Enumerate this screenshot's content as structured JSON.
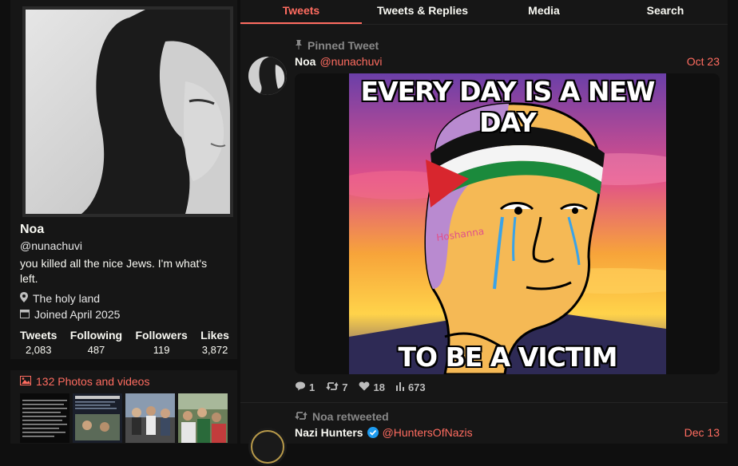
{
  "profile": {
    "name": "Noa",
    "handle": "@nunachuvi",
    "bio": "you killed all the nice Jews. I'm what's left.",
    "location": "The holy land",
    "joined": "Joined April 2025",
    "stats": [
      {
        "label": "Tweets",
        "value": "2,083"
      },
      {
        "label": "Following",
        "value": "487"
      },
      {
        "label": "Followers",
        "value": "119"
      },
      {
        "label": "Likes",
        "value": "3,872"
      }
    ]
  },
  "photos": {
    "title": "132 Photos and videos"
  },
  "tabs": [
    "Tweets",
    "Tweets & Replies",
    "Media",
    "Search"
  ],
  "active_tab": "Tweets",
  "tweets": [
    {
      "pinned_label": "Pinned Tweet",
      "name": "Noa",
      "handle": "@nunachuvi",
      "date": "Oct 23",
      "meme_top": "EVERY DAY IS A NEW DAY",
      "meme_bottom": "TO BE A VICTIM",
      "meme_watermark": "Hoshanna",
      "stats": {
        "replies": "1",
        "retweets": "7",
        "likes": "18",
        "views": "673"
      }
    },
    {
      "retweet_label": "Noa retweeted",
      "name": "Nazi Hunters",
      "handle": "@HuntersOfNazis",
      "date": "Dec 13"
    }
  ],
  "colors": {
    "accent": "#ff6c60",
    "background": "#0f0f0f",
    "panel": "#161616",
    "verified": "#1d9bf0"
  }
}
